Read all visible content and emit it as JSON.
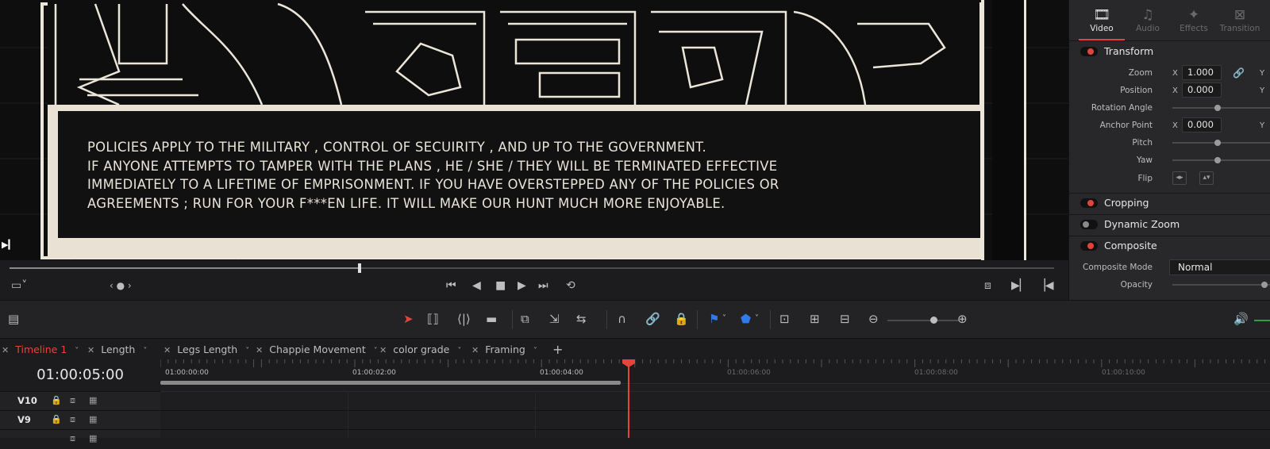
{
  "viewer": {
    "subtitle": "POLICIES APPLY TO THE MILITARY , CONTROL OF SECUIRITY , AND UP TO THE GOVERNMENT.\nIF ANYONE ATTEMPTS TO TAMPER WITH THE PLANS , HE / SHE / THEY WILL BE TERMINATED EFFECTIVE\nIMMEDIATELY TO A LIFETIME OF EMPRISONMENT. IF YOU HAVE OVERSTEPPED ANY OF THE POLICIES OR\nAGREEMENTS ; RUN FOR YOUR F***EN LIFE. IT WILL MAKE OUR HUNT MUCH MORE ENJOYABLE."
  },
  "scrubber": {
    "progress": 0.335
  },
  "inspector": {
    "tabs": [
      "Video",
      "Audio",
      "Effects",
      "Transition"
    ],
    "active_tab": "Video",
    "sections": {
      "transform": "Transform",
      "cropping": "Cropping",
      "dynamic_zoom": "Dynamic Zoom",
      "composite": "Composite"
    },
    "props": {
      "zoom": {
        "label": "Zoom",
        "x_axis": "X",
        "x": "1.000",
        "y_axis": "Y"
      },
      "position": {
        "label": "Position",
        "x_axis": "X",
        "x": "0.000",
        "y_axis": "Y"
      },
      "rotation": {
        "label": "Rotation Angle"
      },
      "anchor": {
        "label": "Anchor Point",
        "x_axis": "X",
        "x": "0.000",
        "y_axis": "Y"
      },
      "pitch": {
        "label": "Pitch"
      },
      "yaw": {
        "label": "Yaw"
      },
      "flip": {
        "label": "Flip"
      },
      "composite_mode": {
        "label": "Composite Mode",
        "value": "Normal"
      },
      "opacity": {
        "label": "Opacity"
      }
    }
  },
  "tabs": [
    "Timeline 1",
    "Length",
    "Legs Length",
    "Chappie Movement",
    "color grade",
    "Framing"
  ],
  "active_tab": "Timeline 1",
  "timeline": {
    "timecode": "01:00:05:00",
    "ruler": [
      "01:00:00:00",
      "01:00:02:00",
      "01:00:04:00",
      "01:00:06:00",
      "01:00:08:00",
      "01:00:10:00"
    ],
    "tracks": [
      "V10",
      "V9"
    ]
  },
  "colors": {
    "accent": "#e2463b",
    "marker_blue": "#2f7bea"
  },
  "icons": [
    "fullscreen-icon",
    "jog-icon",
    "skip-start-icon",
    "prev-frame-icon",
    "stop-icon",
    "play-icon",
    "skip-end-icon",
    "loop-icon",
    "select-tool-icon",
    "trim-tool-icon",
    "blade-tool-icon",
    "snap-icon",
    "link-icon",
    "lock-icon",
    "flag-icon",
    "marker-icon",
    "zoom-out-icon",
    "zoom-in-icon",
    "volume-icon"
  ]
}
